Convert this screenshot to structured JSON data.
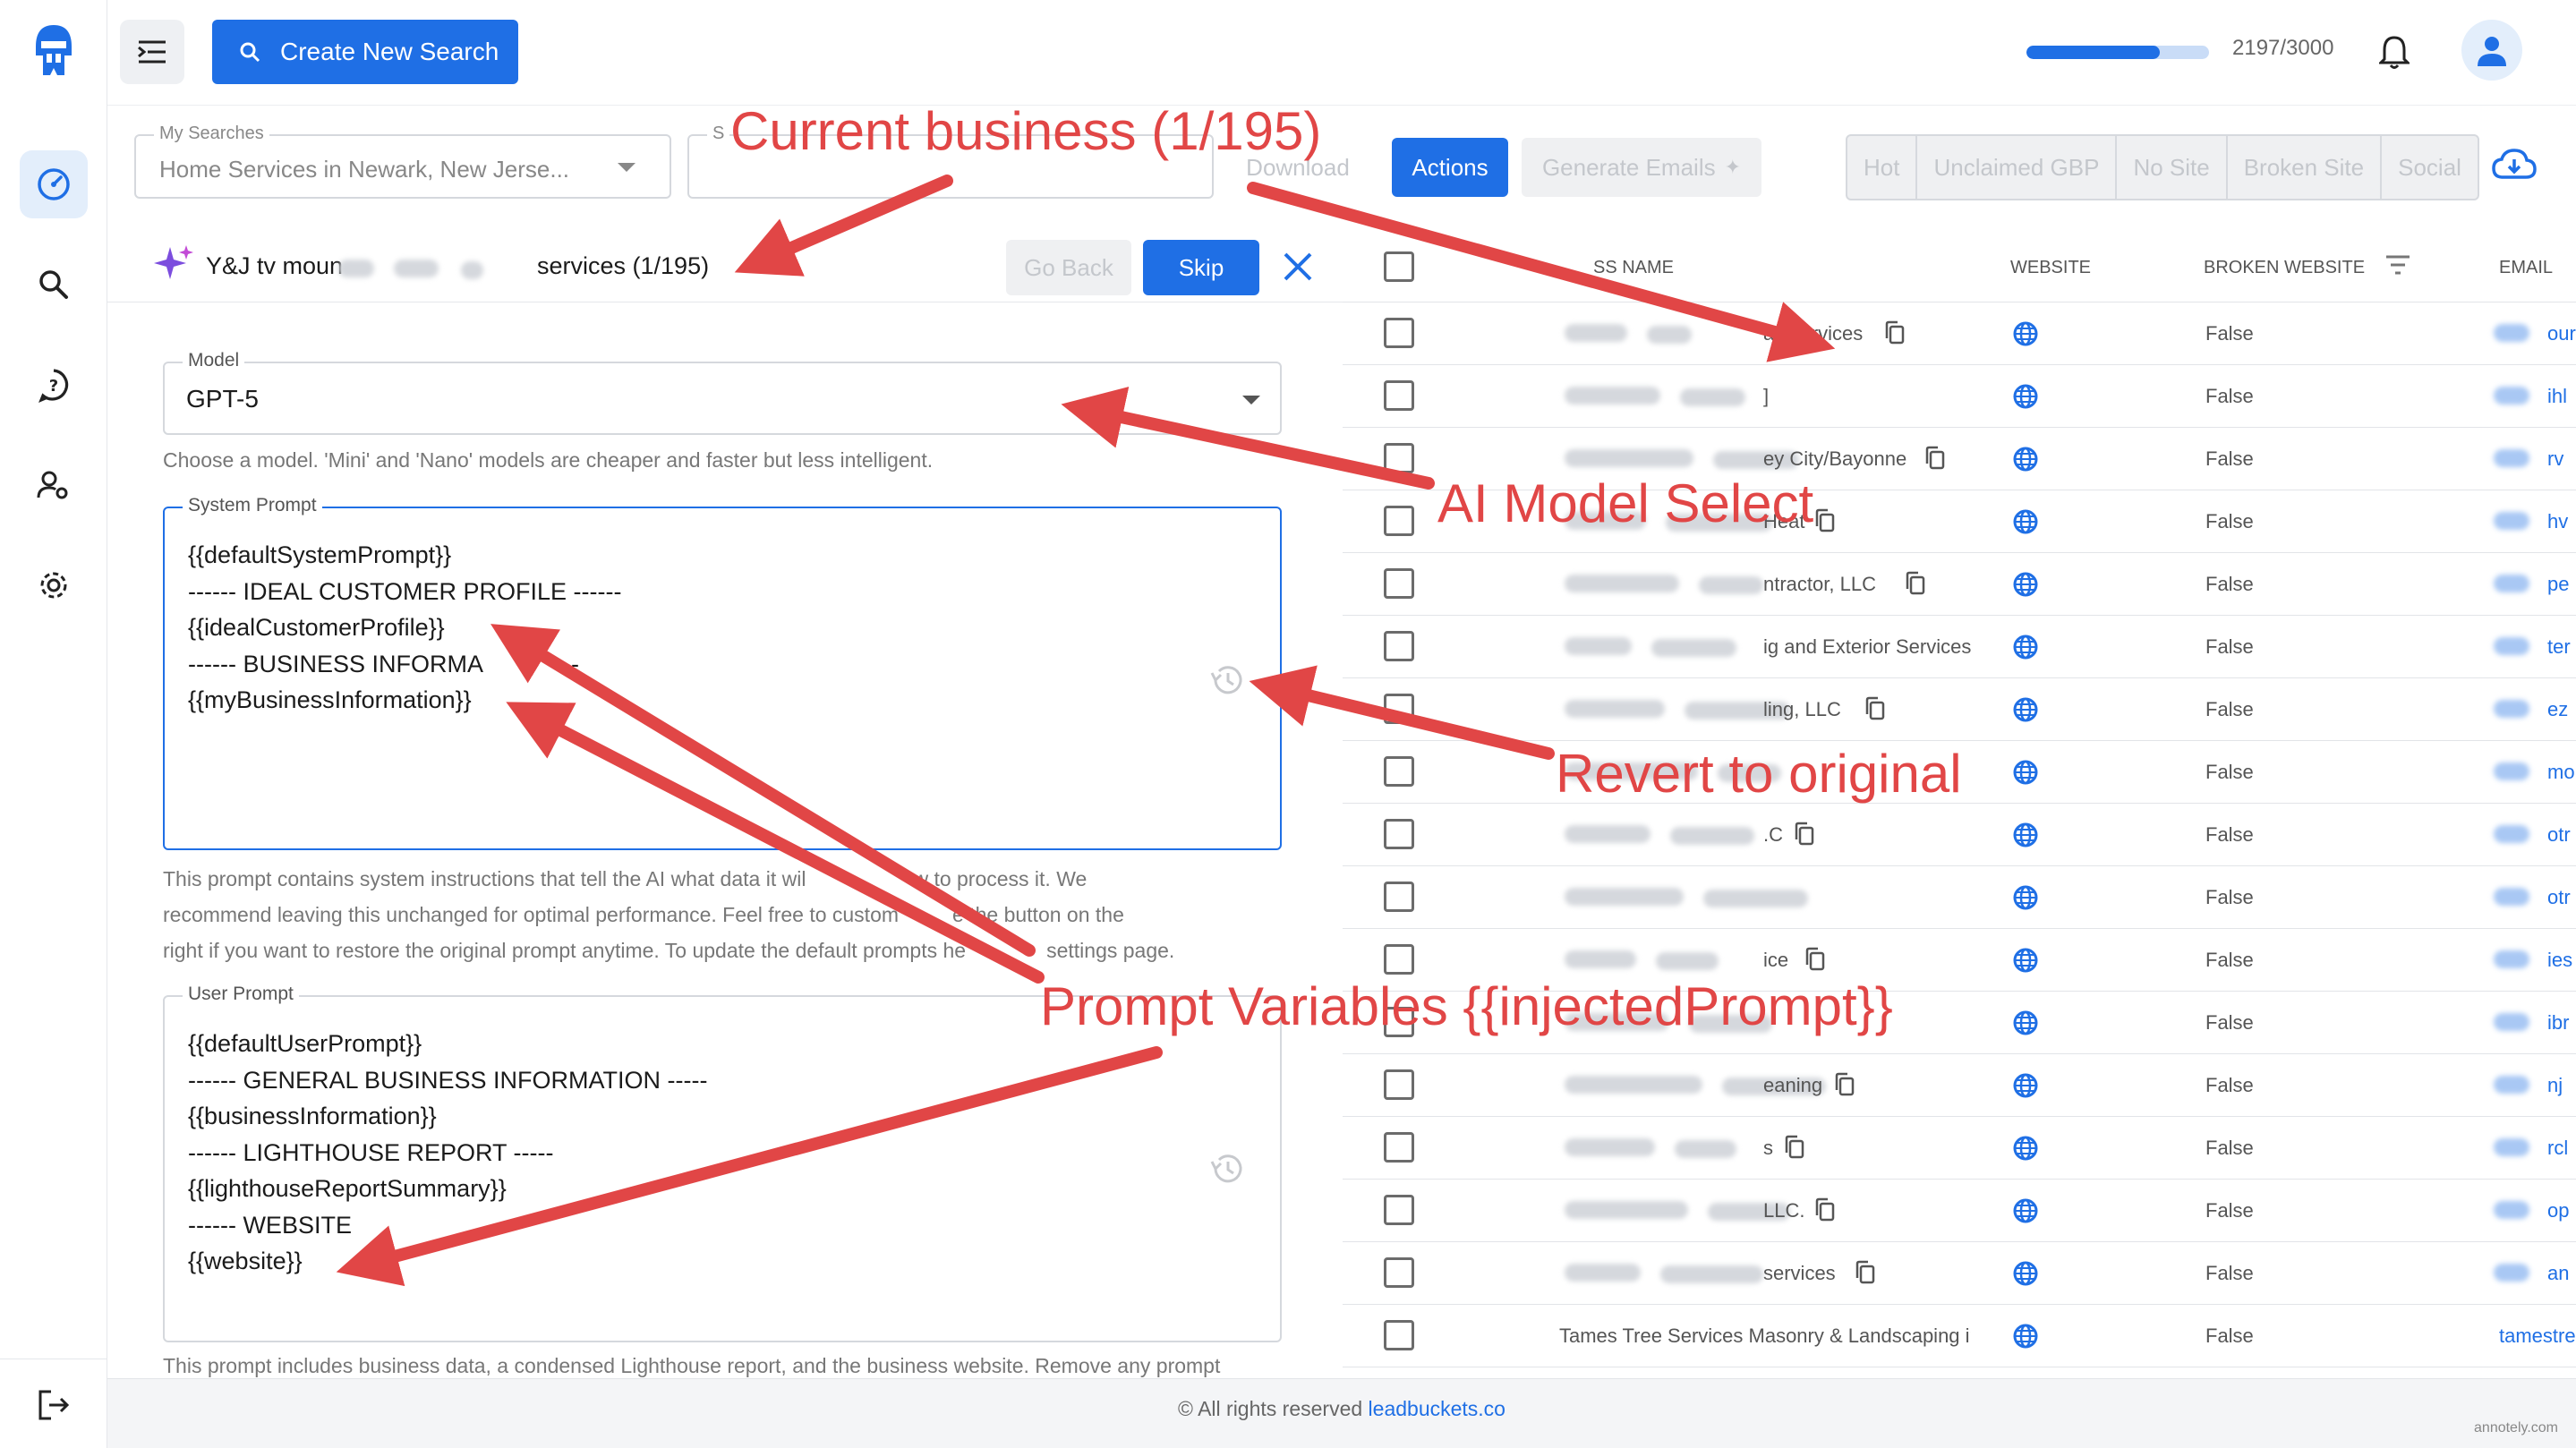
{
  "header": {
    "create_button": "Create New Search",
    "quota_text": "2197/3000",
    "quota_fraction": 0.7323
  },
  "toolbar": {
    "my_searches_legend": "My Searches",
    "my_searches_value": "Home Services in Newark, New Jerse...",
    "second_legend": "S",
    "download": "Download",
    "actions": "Actions",
    "generate_emails": "Generate Emails",
    "filters": [
      "Hot",
      "Unclaimed GBP",
      "No Site",
      "Broken Site",
      "Social"
    ]
  },
  "business_bar": {
    "name_start": "Y&J tv moun",
    "name_end": "services (1/195)",
    "go_back": "Go Back",
    "skip": "Skip"
  },
  "model": {
    "legend": "Model",
    "value": "GPT-5",
    "helper": "Choose a model. 'Mini' and 'Nano' models are cheaper and faster but less intelligent."
  },
  "system_prompt": {
    "legend": "System Prompt",
    "lines": [
      "{{defaultSystemPrompt}}",
      "------ IDEAL CUSTOMER PROFILE ------",
      "{{idealCustomerProfile}}",
      "------ BUSINESS INFORMA",
      "{{myBusinessInformation}}"
    ],
    "line4_tail": "---",
    "helper": [
      "This prompt contains system instructions that tell the AI what data it wil",
      "w to process it. We",
      "recommend leaving this unchanged for optimal performance. Feel free to custom",
      "e the button on the",
      "right if you want to restore the original prompt anytime. To update the default prompts he",
      "settings page."
    ]
  },
  "user_prompt": {
    "legend": "User Prompt",
    "lines": [
      "{{defaultUserPrompt}}",
      "------ GENERAL BUSINESS INFORMATION -----",
      "{{businessInformation}}",
      "------ LIGHTHOUSE REPORT -----",
      "{{lighthouseReportSummary}}",
      "------ WEBSITE",
      "{{website}}"
    ],
    "helper": "This prompt includes business data, a condensed Lighthouse report, and the business website. Remove any prompt"
  },
  "table": {
    "headers": {
      "name": "SS NAME",
      "website": "WEBSITE",
      "broken": "BROKEN WEBSITE",
      "email": "EMAIL"
    },
    "rows": [
      {
        "name": "an services",
        "copy": true,
        "broken": "False",
        "email": "our"
      },
      {
        "name": "]",
        "copy": false,
        "broken": "False",
        "email": "ihl"
      },
      {
        "name": "ey City/Bayonne",
        "copy": true,
        "broken": "False",
        "email": "rv"
      },
      {
        "name": "Heat",
        "copy": true,
        "broken": "False",
        "email": "hv"
      },
      {
        "name": "ntractor, LLC",
        "copy": true,
        "broken": "False",
        "email": "pe"
      },
      {
        "name": "ig and Exterior Services",
        "copy": false,
        "broken": "False",
        "email": "ter"
      },
      {
        "name": "ling, LLC",
        "copy": true,
        "broken": "False",
        "email": "ez"
      },
      {
        "name": "",
        "copy": false,
        "broken": "False",
        "email": "mo"
      },
      {
        "name": ".C",
        "copy": true,
        "broken": "False",
        "email": "otr"
      },
      {
        "name": "",
        "copy": false,
        "broken": "False",
        "email": "otr"
      },
      {
        "name": "ice",
        "copy": true,
        "broken": "False",
        "email": "ies"
      },
      {
        "name": "",
        "copy": false,
        "broken": "False",
        "email": "ibr"
      },
      {
        "name": "eaning",
        "copy": true,
        "broken": "False",
        "email": "nj"
      },
      {
        "name": "s",
        "copy": true,
        "broken": "False",
        "email": "rcl"
      },
      {
        "name": "LLC.",
        "copy": true,
        "broken": "False",
        "email": "op"
      },
      {
        "name": "services",
        "copy": true,
        "broken": "False",
        "email": "an"
      },
      {
        "name": "Tames Tree Services Masonry & Landscaping ir",
        "copy": false,
        "broken": "False",
        "email": "tamestre"
      }
    ]
  },
  "annotations": {
    "current_business": "Current business (1/195)",
    "ai_model_select": "AI Model Select",
    "revert": "Revert to original",
    "prompt_variables": "Prompt Variables {{injectedPrompt}}"
  },
  "footer": {
    "text": "© All rights reserved",
    "link": "leadbuckets.co",
    "watermark": "annotely.com"
  },
  "colors": {
    "primary": "#1f6fe5",
    "annotation": "#e14646"
  }
}
